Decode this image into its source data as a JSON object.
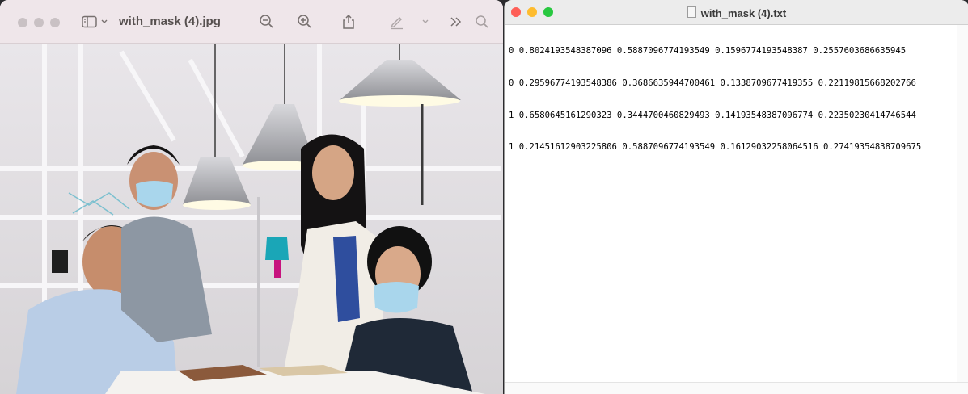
{
  "preview": {
    "title": "with_mask (4).jpg",
    "toolbar_icons": [
      "sidebar-icon",
      "zoom-out-icon",
      "zoom-in-icon",
      "share-icon",
      "markup-icon",
      "more-icon",
      "search-icon"
    ]
  },
  "textedit": {
    "title": "with_mask (4).txt",
    "lines": [
      "0 0.8024193548387096 0.5887096774193549 0.1596774193548387 0.2557603686635945",
      "0 0.29596774193548386 0.3686635944700461 0.1338709677419355 0.22119815668202766",
      "1 0.6580645161290323 0.3444700460829493 0.14193548387096774 0.22350230414746544",
      "1 0.21451612903225806 0.5887096774193549 0.16129032258064516 0.27419354838709675"
    ]
  },
  "colors": {
    "close": "#fe5f57",
    "minimize": "#febc2e",
    "zoom": "#28c840",
    "mask": "#a9d6ec"
  }
}
